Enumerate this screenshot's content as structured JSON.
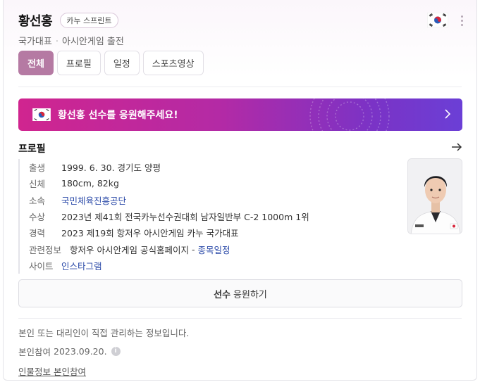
{
  "header": {
    "name": "황선홍",
    "sport": "카누 스프린트",
    "team": "국가대표",
    "event": "아시안게임 출전"
  },
  "tabs": [
    {
      "label": "전체",
      "active": true
    },
    {
      "label": "프로필",
      "active": false
    },
    {
      "label": "일정",
      "active": false
    },
    {
      "label": "스포츠영상",
      "active": false
    }
  ],
  "banner": {
    "text": "황선홍 선수를 응원해주세요!",
    "colors": [
      "#d0258f",
      "#6b3fd6"
    ]
  },
  "profile": {
    "title": "프로필",
    "rows": {
      "birth": {
        "label": "출생",
        "value": "1999. 6. 30. 경기도 양평"
      },
      "body": {
        "label": "신체",
        "value": "180cm, 82kg"
      },
      "team": {
        "label": "소속",
        "value": "국민체육진흥공단"
      },
      "award": {
        "label": "수상",
        "value": "2023년 제41회 전국카누선수권대회 남자일반부 C-2 1000m 1위"
      },
      "career": {
        "label": "경력",
        "value": "2023 제19회 항저우 아시안게임 카누 국가대표"
      },
      "related": {
        "label": "관련정보",
        "value": "항저우 아시안게임 공식홈페이지",
        "sep": "-",
        "link": "종목일정"
      },
      "site": {
        "label": "사이트",
        "value": "인스타그램"
      }
    }
  },
  "cheer": {
    "bold": "선수",
    "rest": "응원하기"
  },
  "footer": {
    "notice": "본인 또는 대리인이 직접 관리하는 정보입니다.",
    "participation_label": "본인참여",
    "participation_date": "2023.09.20.",
    "link": "인물정보 본인참여"
  },
  "icons": {
    "flag": "korea-flag-icon",
    "more": "more-vertical-icon",
    "arrow": "arrow-right-icon",
    "chevron": "chevron-right-icon",
    "info": "info-icon"
  },
  "colors": {
    "accent": "#b57aa3",
    "link": "#2a49a8"
  }
}
